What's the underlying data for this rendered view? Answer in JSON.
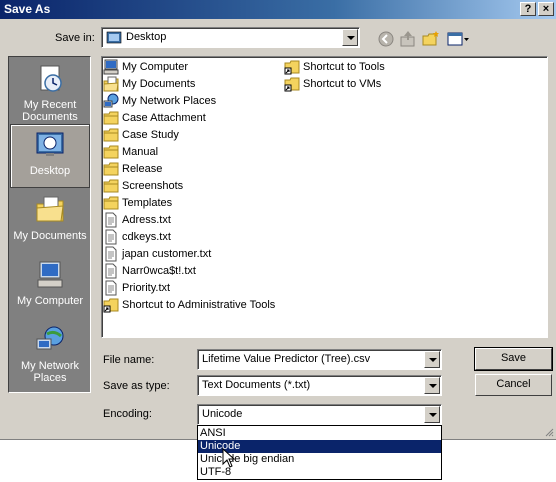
{
  "window": {
    "title": "Save As",
    "help_btn": "?",
    "close_btn": "×"
  },
  "toolbar": {
    "save_in_label": "Save in:",
    "save_in_value": "Desktop",
    "icons": [
      "back-icon",
      "up-folder-icon",
      "new-folder-icon",
      "views-menu-icon"
    ]
  },
  "places": [
    {
      "label": "My Recent Documents",
      "icon": "recent-documents-icon"
    },
    {
      "label": "Desktop",
      "icon": "desktop-icon",
      "active": true
    },
    {
      "label": "My Documents",
      "icon": "my-documents-icon"
    },
    {
      "label": "My Computer",
      "icon": "my-computer-icon"
    },
    {
      "label": "My Network Places",
      "icon": "network-places-icon"
    }
  ],
  "files": {
    "col1": [
      {
        "name": "My Computer",
        "icon": "computer-icon"
      },
      {
        "name": "My Documents",
        "icon": "documents-icon"
      },
      {
        "name": "My Network Places",
        "icon": "network-icon"
      },
      {
        "name": "Case Attachment",
        "icon": "folder-icon"
      },
      {
        "name": "Case Study",
        "icon": "folder-icon"
      },
      {
        "name": "Manual",
        "icon": "folder-icon"
      },
      {
        "name": "Release",
        "icon": "folder-icon"
      },
      {
        "name": "Screenshots",
        "icon": "folder-icon"
      },
      {
        "name": "Templates",
        "icon": "folder-icon"
      },
      {
        "name": "Adress.txt",
        "icon": "text-file-icon"
      },
      {
        "name": "cdkeys.txt",
        "icon": "text-file-icon"
      },
      {
        "name": "japan customer.txt",
        "icon": "text-file-icon"
      },
      {
        "name": "Narr0wca$t!.txt",
        "icon": "text-file-icon"
      },
      {
        "name": "Priority.txt",
        "icon": "text-file-icon"
      },
      {
        "name": "Shortcut to Administrative Tools",
        "icon": "shortcut-folder-icon"
      }
    ],
    "col2": [
      {
        "name": "Shortcut to Tools",
        "icon": "shortcut-folder-icon"
      },
      {
        "name": "Shortcut to VMs",
        "icon": "shortcut-folder-icon"
      }
    ]
  },
  "form": {
    "file_name_label": "File name:",
    "file_name_value": "Lifetime Value Predictor (Tree).csv",
    "save_type_label": "Save as type:",
    "save_type_value": "Text Documents (*.txt)",
    "encoding_label": "Encoding:",
    "encoding_value": "Unicode"
  },
  "buttons": {
    "save": "Save",
    "cancel": "Cancel"
  },
  "encoding_options": [
    {
      "label": "ANSI",
      "selected": false
    },
    {
      "label": "Unicode",
      "selected": true
    },
    {
      "label": "Unicode big endian",
      "selected": false
    },
    {
      "label": "UTF-8",
      "selected": false
    }
  ],
  "colors": {
    "title_bar": "#0a246a",
    "selection": "#0a246a",
    "face": "#d4d0c8",
    "places_bg": "#808080"
  }
}
